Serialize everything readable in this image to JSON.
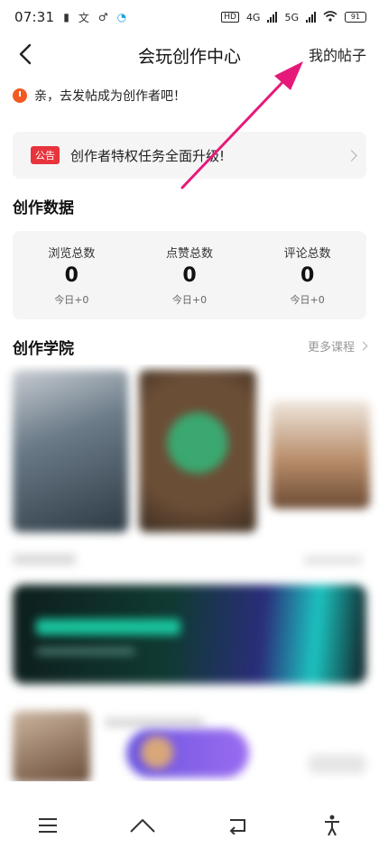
{
  "status_bar": {
    "time": "07:31",
    "network_hd": "HD",
    "network_4g": "4G",
    "network_5g": "5G",
    "battery": "91"
  },
  "header": {
    "title": "会玩创作中心",
    "my_posts": "我的帖子"
  },
  "tip": {
    "text": "亲，去发帖成为创作者吧！"
  },
  "announcement": {
    "badge": "公告",
    "text": "创作者特权任务全面升级!"
  },
  "stats_section": {
    "title": "创作数据",
    "items": [
      {
        "label": "浏览总数",
        "value": "0",
        "sub": "今日+0"
      },
      {
        "label": "点赞总数",
        "value": "0",
        "sub": "今日+0"
      },
      {
        "label": "评论总数",
        "value": "0",
        "sub": "今日+0"
      }
    ]
  },
  "academy_section": {
    "title": "创作学院",
    "more": "更多课程"
  },
  "colors": {
    "accent_red": "#e8343c",
    "annotation_arrow": "#e6197a"
  },
  "icons": {
    "back": "chevron-left-icon",
    "menu": "menu-icon",
    "home": "home-icon",
    "recent": "back-icon",
    "accessibility": "person-icon"
  }
}
